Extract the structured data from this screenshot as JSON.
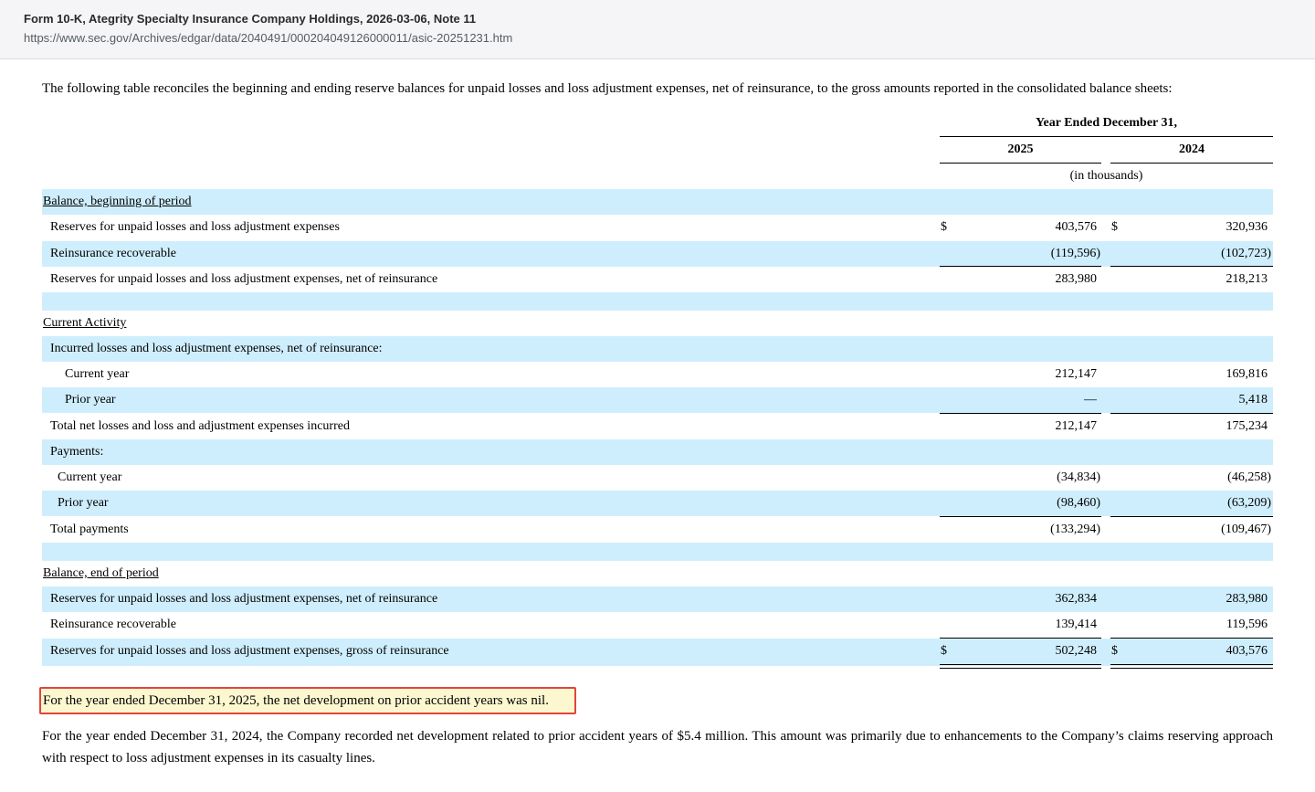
{
  "header": {
    "title": "Form 10-K, Ategrity Specialty Insurance Company Holdings, 2026-03-06, Note 11",
    "url": "https://www.sec.gov/Archives/edgar/data/2040491/000204049126000011/asic-20251231.htm"
  },
  "intro": "The following table reconciles the beginning and ending reserve balances for unpaid losses and loss adjustment expenses, net of reinsurance, to the gross amounts reported in the consolidated balance sheets:",
  "table": {
    "period_header": "Year Ended December 31,",
    "col_2025": "2025",
    "col_2024": "2024",
    "units": "(in thousands)",
    "rows": [
      {
        "label": "Balance, beginning of period"
      },
      {
        "label": "Reserves for unpaid losses and loss adjustment expenses",
        "v2025": "403,576",
        "v2024": "320,936",
        "cur": "$"
      },
      {
        "label": "Reinsurance recoverable",
        "v2025": "(119,596)",
        "v2024": "(102,723)"
      },
      {
        "label": "Reserves for unpaid losses and loss adjustment expenses, net of reinsurance",
        "v2025": "283,980",
        "v2024": "218,213"
      },
      {
        "label": ""
      },
      {
        "label": "Current Activity"
      },
      {
        "label": "Incurred losses and loss adjustment expenses, net of reinsurance:"
      },
      {
        "label": "Current year",
        "v2025": "212,147",
        "v2024": "169,816"
      },
      {
        "label": "Prior year",
        "v2025": "—",
        "v2024": "5,418"
      },
      {
        "label": "Total net losses and loss and adjustment expenses incurred",
        "v2025": "212,147",
        "v2024": "175,234"
      },
      {
        "label": "Payments:"
      },
      {
        "label": "Current year",
        "v2025": "(34,834)",
        "v2024": "(46,258)"
      },
      {
        "label": "Prior year",
        "v2025": "(98,460)",
        "v2024": "(63,209)"
      },
      {
        "label": "Total payments",
        "v2025": "(133,294)",
        "v2024": "(109,467)"
      },
      {
        "label": ""
      },
      {
        "label": "Balance, end of period"
      },
      {
        "label": "Reserves for unpaid losses and loss adjustment expenses, net of reinsurance",
        "v2025": "362,834",
        "v2024": "283,980"
      },
      {
        "label": "Reinsurance recoverable",
        "v2025": "139,414",
        "v2024": "119,596"
      },
      {
        "label": "Reserves for unpaid losses and loss adjustment expenses, gross of reinsurance",
        "v2025": "502,248",
        "v2024": "403,576",
        "cur": "$"
      }
    ]
  },
  "highlight_note": "For the year ended December 31, 2025, the net development on prior accident years was nil.",
  "paragraph": "For the year ended December 31, 2024, the Company recorded net development related to prior accident years of $5.4 million. This amount was primarily due to enhancements to the Company’s claims reserving approach with respect to loss adjustment expenses in its casualty lines.",
  "colors": {
    "row_band": "#cfeefd",
    "highlight_border": "#e0453a",
    "highlight_fill": "#fdf7d0"
  }
}
